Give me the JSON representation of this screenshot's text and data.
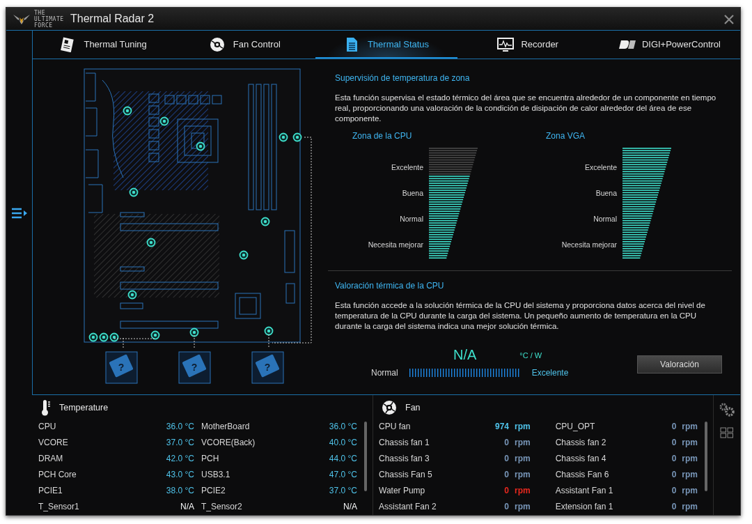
{
  "window": {
    "title": "Thermal Radar 2",
    "logo_text": "THE ULTIMATE FORCE"
  },
  "tabs": [
    {
      "label": "Thermal Tuning",
      "selected": false
    },
    {
      "label": "Fan Control",
      "selected": false
    },
    {
      "label": "Thermal Status",
      "selected": true
    },
    {
      "label": "Recorder",
      "selected": false
    },
    {
      "label": "DIGI+PowerControl",
      "selected": false
    }
  ],
  "external_sensors": [
    {
      "label": "?"
    },
    {
      "label": "?"
    },
    {
      "label": "?"
    }
  ],
  "zone_monitor": {
    "title": "Supervisión de temperatura de zona",
    "description": "Esta función supervisa el estado térmico del área que se encuentra alrededor de un componente en tiempo real, proporcionando una valoración de la condición de disipación de calor alrededor del área de ese componente.",
    "zones": [
      {
        "title": "Zona de la CPU",
        "level": 0.76,
        "labels": [
          "Excelente",
          "Buena",
          "Normal",
          "Necesita mejorar"
        ]
      },
      {
        "title": "Zona VGA",
        "level": 1.0,
        "labels": [
          "Excelente",
          "Buena",
          "Normal",
          "Necesita mejorar"
        ]
      }
    ]
  },
  "cpu_rating": {
    "title": "Valoración térmica de la CPU",
    "description": "Esta función accede a la solución térmica de la CPU del sistema y proporciona datos acerca del nivel de temperatura de la CPU durante la carga del sistema. Un pequeño aumento de temperatura en la CPU durante la carga del sistema indica una mejor solución térmica.",
    "value": "N/A",
    "unit": "°C / W",
    "low_label": "Normal",
    "high_label": "Excelente",
    "button": "Valoración"
  },
  "temperature": {
    "title": "Temperature",
    "rows": [
      {
        "name": "CPU",
        "value": "36.0 °C"
      },
      {
        "name": "MotherBoard",
        "value": "36.0 °C"
      },
      {
        "name": "VCORE",
        "value": "37.0 °C"
      },
      {
        "name": "VCORE(Back)",
        "value": "40.0 °C"
      },
      {
        "name": "DRAM",
        "value": "42.0 °C"
      },
      {
        "name": "PCH",
        "value": "44.0 °C"
      },
      {
        "name": "PCH Core",
        "value": "43.0 °C"
      },
      {
        "name": "USB3.1",
        "value": "47.0 °C"
      },
      {
        "name": "PCIE1",
        "value": "38.0 °C"
      },
      {
        "name": "PCIE2",
        "value": "37.0 °C"
      },
      {
        "name": "T_Sensor1",
        "value": "N/A"
      },
      {
        "name": "T_Sensor2",
        "value": "N/A"
      }
    ]
  },
  "fan": {
    "title": "Fan",
    "rows": [
      {
        "name": "CPU fan",
        "value": "974",
        "unit": "rpm",
        "color": "#4fc3ea"
      },
      {
        "name": "CPU_OPT",
        "value": "0",
        "unit": "rpm",
        "color": "#7896b8"
      },
      {
        "name": "Chassis fan 1",
        "value": "0",
        "unit": "rpm",
        "color": "#7896b8"
      },
      {
        "name": "Chassis fan 2",
        "value": "0",
        "unit": "rpm",
        "color": "#7896b8"
      },
      {
        "name": "Chassis fan 3",
        "value": "0",
        "unit": "rpm",
        "color": "#7896b8"
      },
      {
        "name": "Chassis fan 4",
        "value": "0",
        "unit": "rpm",
        "color": "#7896b8"
      },
      {
        "name": "Chassis Fan 5",
        "value": "0",
        "unit": "rpm",
        "color": "#7896b8"
      },
      {
        "name": "Chassis Fan 6",
        "value": "0",
        "unit": "rpm",
        "color": "#7896b8"
      },
      {
        "name": "Water Pump",
        "value": "0",
        "unit": "rpm",
        "color": "#e8281e"
      },
      {
        "name": "Assistant Fan 1",
        "value": "0",
        "unit": "rpm",
        "color": "#7896b8"
      },
      {
        "name": "Assistant Fan 2",
        "value": "0",
        "unit": "rpm",
        "color": "#7896b8"
      },
      {
        "name": "Extension fan 1",
        "value": "0",
        "unit": "rpm",
        "color": "#7896b8"
      }
    ]
  }
}
